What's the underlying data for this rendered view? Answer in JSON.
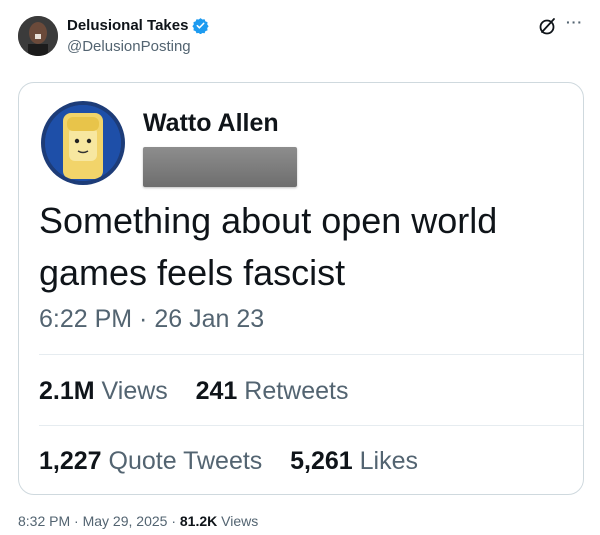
{
  "author": {
    "name": "Delusional Takes",
    "handle": "@DelusionPosting"
  },
  "icons": {
    "verified": "verified-badge-icon",
    "grok": "grok-icon",
    "more": "more-icon",
    "accent": "#1d9bf0"
  },
  "quoted_screenshot": {
    "name": "Watto Allen",
    "text": "Something about open world games feels fascist",
    "time": "6:22 PM · 26 Jan 23",
    "stats": {
      "views_count": "2.1M",
      "views_label": "Views",
      "retweets_count": "241",
      "retweets_label": "Retweets",
      "quotes_count": "1,227",
      "quotes_label": "Quote Tweets",
      "likes_count": "5,261",
      "likes_label": "Likes"
    }
  },
  "post_meta": {
    "time": "8:32 PM",
    "sep1": "·",
    "date": "May 29, 2025",
    "sep2": "·",
    "views_count": "81.2K",
    "views_label": "Views"
  }
}
